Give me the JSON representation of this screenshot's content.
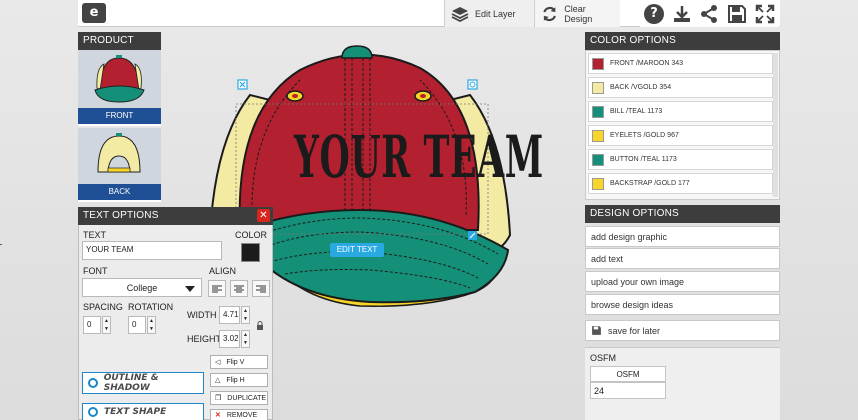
{
  "toolbar": {
    "edit_layer": "Edit Layer",
    "clear_design": "Clear Design"
  },
  "product_view": {
    "title": "PRODUCT VIEW",
    "front": "FRONT",
    "back": "BACK"
  },
  "canvas": {
    "design_text": "YOUR TEAM",
    "edit_text_label": "EDIT TEXT",
    "colors": {
      "crown": "#b3202f",
      "bill": "#159078",
      "back": "#f3eba3",
      "gold": "#f7d629",
      "outline": "#1b1b1b"
    }
  },
  "color_options": {
    "title": "COLOR OPTIONS",
    "items": [
      {
        "label": "FRONT  /MAROON 343",
        "color": "#b3202f"
      },
      {
        "label": "BACK  /VGOLD 354",
        "color": "#f3eba3"
      },
      {
        "label": "BILL  /TEAL 1173",
        "color": "#159078"
      },
      {
        "label": "EYELETS  /GOLD 967",
        "color": "#f7d629"
      },
      {
        "label": "BUTTON  /TEAL 1173",
        "color": "#159078"
      },
      {
        "label": "BACKSTRAP  /GOLD 177",
        "color": "#f7d629"
      }
    ]
  },
  "design_options": {
    "title": "DESIGN OPTIONS",
    "items": [
      "add design graphic",
      "add text",
      "upload your own image",
      "browse design ideas"
    ],
    "save": "save for later"
  },
  "osfm": {
    "title": "OSFM",
    "header": "OSFM",
    "quantity": "24"
  },
  "text_options": {
    "title": "TEXT OPTIONS",
    "text_label": "TEXT",
    "text_value": "YOUR TEAM",
    "color_label": "COLOR",
    "font_label": "FONT",
    "font_value": "College",
    "align_label": "ALIGN",
    "spacing_label": "SPACING",
    "spacing_value": "0",
    "rotation_label": "ROTATION",
    "rotation_value": "0",
    "width_label": "WIDTH",
    "width_value": "4.71",
    "height_label": "HEIGHT",
    "height_value": "3.02",
    "flip_v": "Flip V",
    "flip_h": "Flip H",
    "duplicate": "DUPLICATE",
    "remove": "REMOVE",
    "outline_shadow": "OUTLINE & SHADOW",
    "text_shape": "TEXT SHAPE"
  }
}
